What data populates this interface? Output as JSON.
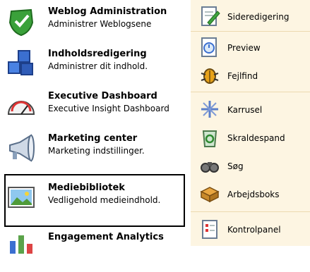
{
  "left_items": [
    {
      "title": "Weblog Administration",
      "subtitle": "Administrer Weblogsene",
      "icon": "weblog-shield-icon"
    },
    {
      "title": "Indholdsredigering",
      "subtitle": "Administrer dit indhold.",
      "icon": "content-blocks-icon"
    },
    {
      "title": "Executive Dashboard",
      "subtitle": "Executive Insight Dashboard",
      "icon": "gauge-icon"
    },
    {
      "title": "Marketing center",
      "subtitle": "Marketing indstillinger.",
      "icon": "megaphone-icon"
    },
    {
      "title": "Mediebibliotek",
      "subtitle": "Vedligehold medieindhold.",
      "icon": "landscape-picture-icon",
      "selected": true
    },
    {
      "title": "Engagement Analytics",
      "subtitle": "",
      "icon": "bar-chart-icon"
    }
  ],
  "right_items": [
    {
      "label": "Sideredigering",
      "icon": "page-edit-icon"
    },
    {
      "label": "Preview",
      "icon": "preview-icon"
    },
    {
      "label": "Fejlfind",
      "icon": "bug-icon"
    },
    {
      "label": "Karrusel",
      "icon": "carousel-icon"
    },
    {
      "label": "Skraldespand",
      "icon": "recycle-bin-icon"
    },
    {
      "label": "Søg",
      "icon": "binoculars-icon"
    },
    {
      "label": "Arbejdsboks",
      "icon": "workbox-icon"
    },
    {
      "label": "Kontrolpanel",
      "icon": "control-panel-icon"
    }
  ],
  "colors": {
    "right_panel_bg": "#fdf5e2",
    "separator": "#ecd9b0"
  }
}
